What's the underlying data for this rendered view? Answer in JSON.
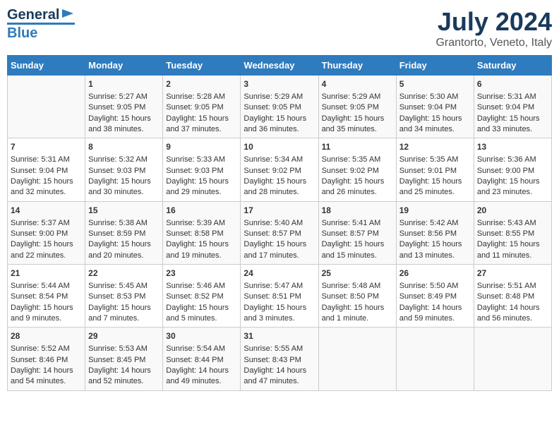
{
  "header": {
    "logo_general": "General",
    "logo_blue": "Blue",
    "title": "July 2024",
    "subtitle": "Grantorto, Veneto, Italy"
  },
  "weekdays": [
    "Sunday",
    "Monday",
    "Tuesday",
    "Wednesday",
    "Thursday",
    "Friday",
    "Saturday"
  ],
  "weeks": [
    [
      {
        "day": "",
        "content": ""
      },
      {
        "day": "1",
        "content": "Sunrise: 5:27 AM\nSunset: 9:05 PM\nDaylight: 15 hours\nand 38 minutes."
      },
      {
        "day": "2",
        "content": "Sunrise: 5:28 AM\nSunset: 9:05 PM\nDaylight: 15 hours\nand 37 minutes."
      },
      {
        "day": "3",
        "content": "Sunrise: 5:29 AM\nSunset: 9:05 PM\nDaylight: 15 hours\nand 36 minutes."
      },
      {
        "day": "4",
        "content": "Sunrise: 5:29 AM\nSunset: 9:05 PM\nDaylight: 15 hours\nand 35 minutes."
      },
      {
        "day": "5",
        "content": "Sunrise: 5:30 AM\nSunset: 9:04 PM\nDaylight: 15 hours\nand 34 minutes."
      },
      {
        "day": "6",
        "content": "Sunrise: 5:31 AM\nSunset: 9:04 PM\nDaylight: 15 hours\nand 33 minutes."
      }
    ],
    [
      {
        "day": "7",
        "content": "Sunrise: 5:31 AM\nSunset: 9:04 PM\nDaylight: 15 hours\nand 32 minutes."
      },
      {
        "day": "8",
        "content": "Sunrise: 5:32 AM\nSunset: 9:03 PM\nDaylight: 15 hours\nand 30 minutes."
      },
      {
        "day": "9",
        "content": "Sunrise: 5:33 AM\nSunset: 9:03 PM\nDaylight: 15 hours\nand 29 minutes."
      },
      {
        "day": "10",
        "content": "Sunrise: 5:34 AM\nSunset: 9:02 PM\nDaylight: 15 hours\nand 28 minutes."
      },
      {
        "day": "11",
        "content": "Sunrise: 5:35 AM\nSunset: 9:02 PM\nDaylight: 15 hours\nand 26 minutes."
      },
      {
        "day": "12",
        "content": "Sunrise: 5:35 AM\nSunset: 9:01 PM\nDaylight: 15 hours\nand 25 minutes."
      },
      {
        "day": "13",
        "content": "Sunrise: 5:36 AM\nSunset: 9:00 PM\nDaylight: 15 hours\nand 23 minutes."
      }
    ],
    [
      {
        "day": "14",
        "content": "Sunrise: 5:37 AM\nSunset: 9:00 PM\nDaylight: 15 hours\nand 22 minutes."
      },
      {
        "day": "15",
        "content": "Sunrise: 5:38 AM\nSunset: 8:59 PM\nDaylight: 15 hours\nand 20 minutes."
      },
      {
        "day": "16",
        "content": "Sunrise: 5:39 AM\nSunset: 8:58 PM\nDaylight: 15 hours\nand 19 minutes."
      },
      {
        "day": "17",
        "content": "Sunrise: 5:40 AM\nSunset: 8:57 PM\nDaylight: 15 hours\nand 17 minutes."
      },
      {
        "day": "18",
        "content": "Sunrise: 5:41 AM\nSunset: 8:57 PM\nDaylight: 15 hours\nand 15 minutes."
      },
      {
        "day": "19",
        "content": "Sunrise: 5:42 AM\nSunset: 8:56 PM\nDaylight: 15 hours\nand 13 minutes."
      },
      {
        "day": "20",
        "content": "Sunrise: 5:43 AM\nSunset: 8:55 PM\nDaylight: 15 hours\nand 11 minutes."
      }
    ],
    [
      {
        "day": "21",
        "content": "Sunrise: 5:44 AM\nSunset: 8:54 PM\nDaylight: 15 hours\nand 9 minutes."
      },
      {
        "day": "22",
        "content": "Sunrise: 5:45 AM\nSunset: 8:53 PM\nDaylight: 15 hours\nand 7 minutes."
      },
      {
        "day": "23",
        "content": "Sunrise: 5:46 AM\nSunset: 8:52 PM\nDaylight: 15 hours\nand 5 minutes."
      },
      {
        "day": "24",
        "content": "Sunrise: 5:47 AM\nSunset: 8:51 PM\nDaylight: 15 hours\nand 3 minutes."
      },
      {
        "day": "25",
        "content": "Sunrise: 5:48 AM\nSunset: 8:50 PM\nDaylight: 15 hours\nand 1 minute."
      },
      {
        "day": "26",
        "content": "Sunrise: 5:50 AM\nSunset: 8:49 PM\nDaylight: 14 hours\nand 59 minutes."
      },
      {
        "day": "27",
        "content": "Sunrise: 5:51 AM\nSunset: 8:48 PM\nDaylight: 14 hours\nand 56 minutes."
      }
    ],
    [
      {
        "day": "28",
        "content": "Sunrise: 5:52 AM\nSunset: 8:46 PM\nDaylight: 14 hours\nand 54 minutes."
      },
      {
        "day": "29",
        "content": "Sunrise: 5:53 AM\nSunset: 8:45 PM\nDaylight: 14 hours\nand 52 minutes."
      },
      {
        "day": "30",
        "content": "Sunrise: 5:54 AM\nSunset: 8:44 PM\nDaylight: 14 hours\nand 49 minutes."
      },
      {
        "day": "31",
        "content": "Sunrise: 5:55 AM\nSunset: 8:43 PM\nDaylight: 14 hours\nand 47 minutes."
      },
      {
        "day": "",
        "content": ""
      },
      {
        "day": "",
        "content": ""
      },
      {
        "day": "",
        "content": ""
      }
    ]
  ]
}
